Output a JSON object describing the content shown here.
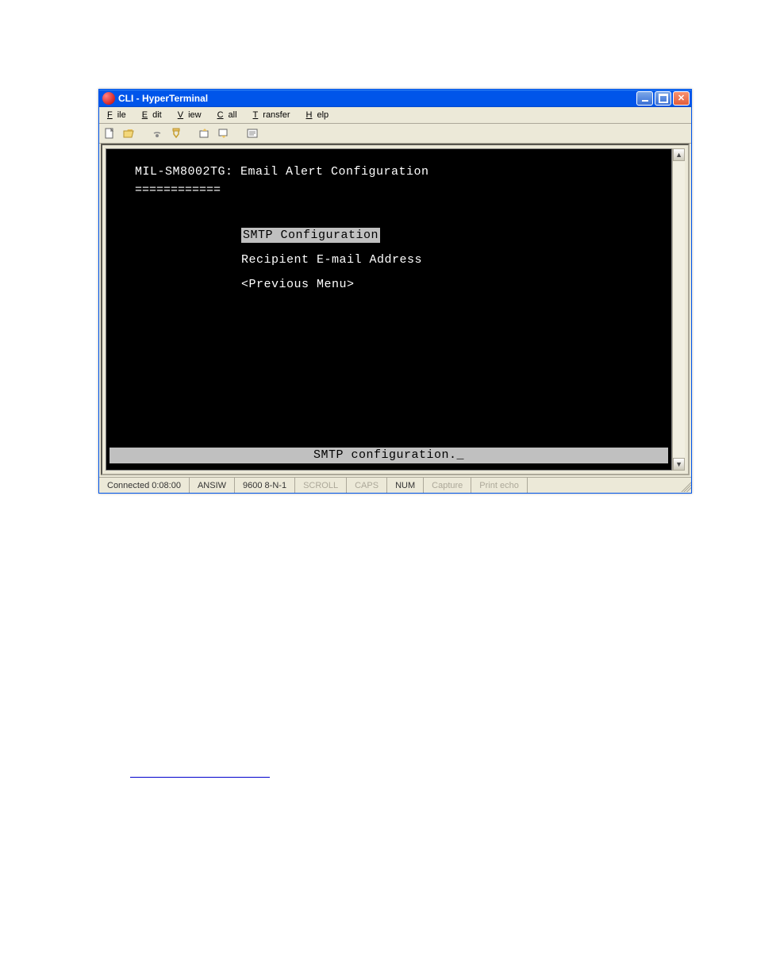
{
  "window": {
    "title": "CLI - HyperTerminal"
  },
  "menubar": {
    "items": [
      {
        "key": "F",
        "rest": "ile"
      },
      {
        "key": "E",
        "rest": "dit"
      },
      {
        "key": "V",
        "rest": "iew"
      },
      {
        "key": "C",
        "rest": "all"
      },
      {
        "key": "T",
        "rest": "ransfer"
      },
      {
        "key": "H",
        "rest": "elp"
      }
    ]
  },
  "terminal": {
    "header": "MIL-SM8002TG: Email Alert Configuration",
    "underline": "============",
    "menu": {
      "items": [
        {
          "label": "SMTP Configuration",
          "selected": true
        },
        {
          "label": "Recipient E-mail Address",
          "selected": false
        },
        {
          "label": "<Previous Menu>",
          "selected": false
        }
      ]
    },
    "status_message": "SMTP configuration._"
  },
  "statusbar": {
    "connected": "Connected 0:08:00",
    "emulation": "ANSIW",
    "port_settings": "9600 8-N-1",
    "indicators": {
      "scroll": "SCROLL",
      "caps": "CAPS",
      "num": "NUM",
      "capture": "Capture",
      "print_echo": "Print echo"
    }
  }
}
